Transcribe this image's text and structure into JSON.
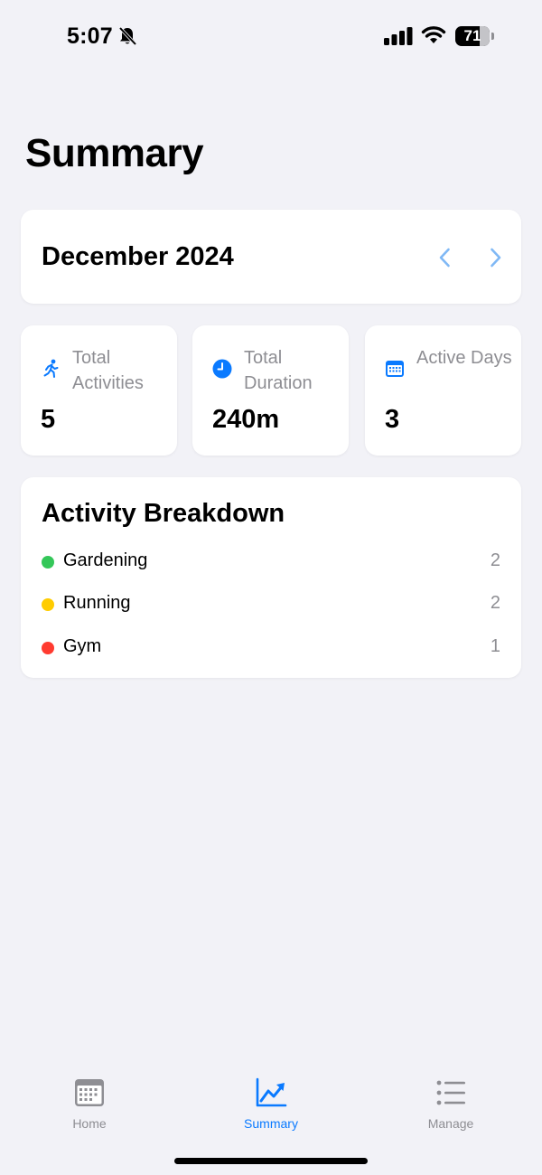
{
  "status_bar": {
    "time": "5:07",
    "battery": "71",
    "battery_level": 0.71
  },
  "page": {
    "title": "Summary"
  },
  "month_nav": {
    "label": "December 2024",
    "prev_icon": "chevron-left-icon",
    "next_icon": "chevron-right-icon"
  },
  "stats": [
    {
      "label": "Total Activities",
      "value": "5",
      "icon": "running-icon"
    },
    {
      "label": "Total Duration",
      "value": "240m",
      "icon": "clock-icon"
    },
    {
      "label": "Active Days",
      "value": "3",
      "icon": "calendar-icon"
    }
  ],
  "breakdown": {
    "title": "Activity Breakdown",
    "items": [
      {
        "name": "Gardening",
        "count": "2",
        "color": "#34C759"
      },
      {
        "name": "Running",
        "count": "2",
        "color": "#FFCC00"
      },
      {
        "name": "Gym",
        "count": "1",
        "color": "#FF3B30"
      }
    ]
  },
  "tabs": [
    {
      "label": "Home",
      "icon": "calendar-grid-icon",
      "active": false
    },
    {
      "label": "Summary",
      "icon": "chart-line-icon",
      "active": true
    },
    {
      "label": "Manage",
      "icon": "list-icon",
      "active": false
    }
  ],
  "colors": {
    "accent": "#0A7AFF",
    "accent_light": "#7FB8F5",
    "background": "#F2F2F7",
    "secondary_text": "#8E8E93"
  }
}
